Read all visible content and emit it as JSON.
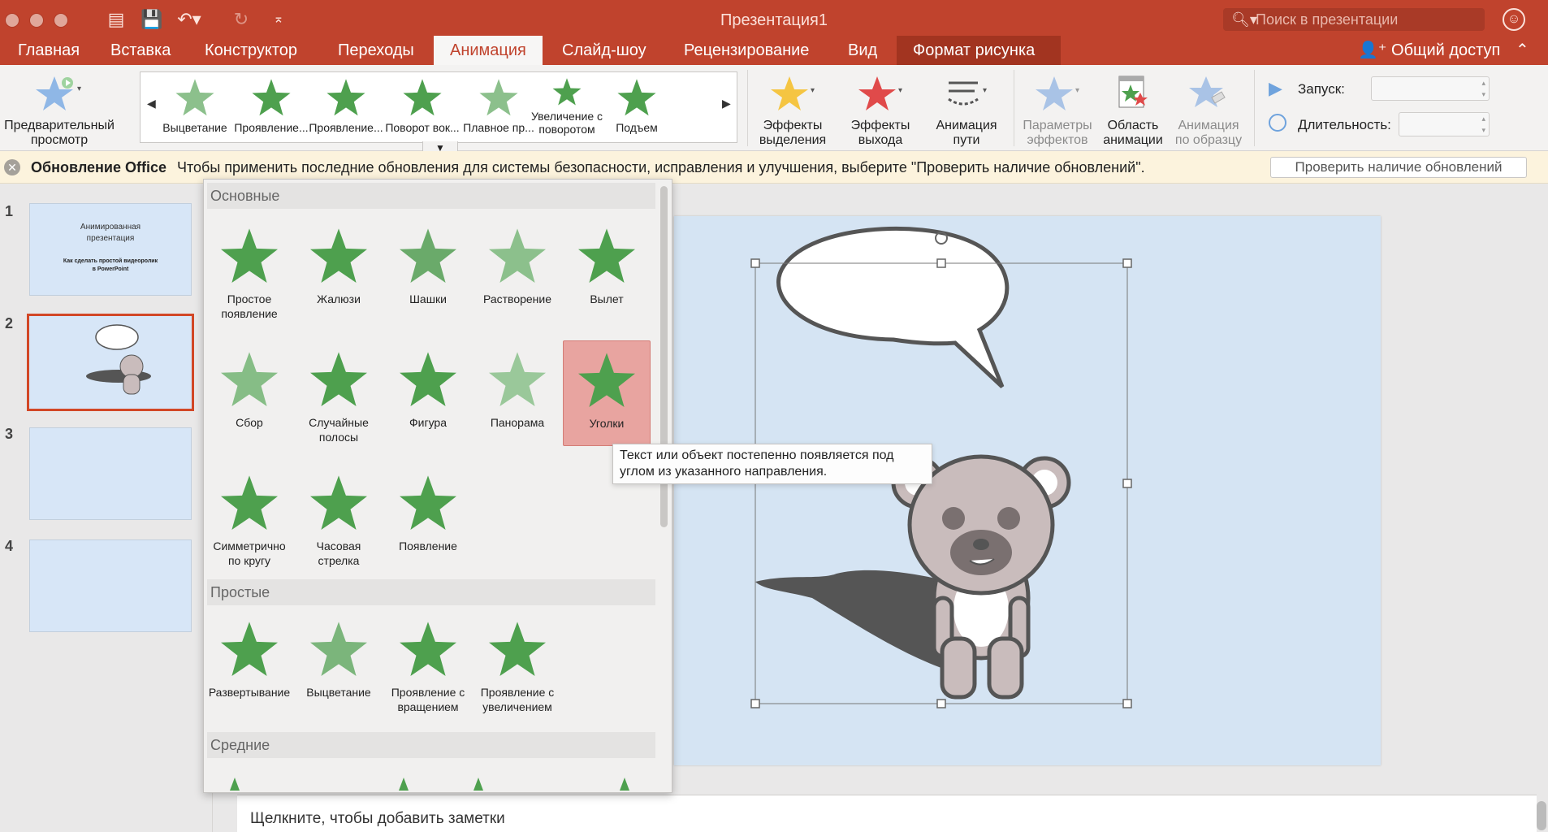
{
  "window": {
    "title": "Презентация1",
    "search_placeholder": "Поиск в презентации"
  },
  "tabs": [
    "Главная",
    "Вставка",
    "Конструктор",
    "Переходы",
    "Анимация",
    "Слайд-шоу",
    "Рецензирование",
    "Вид",
    "Формат рисунка"
  ],
  "active_tab": "Анимация",
  "share_label": "Общий доступ",
  "ribbon": {
    "preview": [
      "Предварительный",
      "просмотр"
    ],
    "gallery_items": [
      {
        "label": "Выцветание",
        "icon": "star-fade-icon"
      },
      {
        "label": "Проявление...",
        "icon": "star-spin-icon"
      },
      {
        "label": "Проявление...",
        "icon": "star-zoom-icon"
      },
      {
        "label": "Поворот вок...",
        "icon": "star-turn-icon"
      },
      {
        "label": "Плавное пр...",
        "icon": "star-float-icon"
      },
      {
        "label": "Увеличение с поворотом",
        "icon": "star-grow-turn-icon"
      },
      {
        "label": "Подъем",
        "icon": "star-rise-icon"
      }
    ],
    "effects_emphasis": [
      "Эффекты",
      "выделения"
    ],
    "effects_exit": [
      "Эффекты",
      "выхода"
    ],
    "motion_path": [
      "Анимация",
      "пути"
    ],
    "effect_options": [
      "Параметры",
      "эффектов"
    ],
    "animation_pane": [
      "Область",
      "анимации"
    ],
    "animation_painter": [
      "Анимация",
      "по образцу"
    ],
    "start_label": "Запуск:",
    "duration_label": "Длительность:"
  },
  "message_bar": {
    "title": "Обновление Office",
    "text": "Чтобы применить последние обновления для системы безопасности, исправления и улучшения, выберите \"Проверить наличие обновлений\".",
    "button": "Проверить наличие обновлений"
  },
  "slides": [
    {
      "number": "1",
      "title": "Анимированная презентация",
      "subtitle": "Как сделать простой видеоролик в PowerPoint"
    },
    {
      "number": "2"
    },
    {
      "number": "3"
    },
    {
      "number": "4"
    }
  ],
  "selected_slide": "2",
  "dropdown": {
    "sections": [
      {
        "title": "Основные",
        "items": [
          "Простое появление",
          "Жалюзи",
          "Шашки",
          "Растворение",
          "Вылет",
          "Сбор",
          "Случайные полосы",
          "Фигура",
          "Панорама",
          "Уголки",
          "Симметрично по кругу",
          "Часовая стрелка",
          "Появление"
        ]
      },
      {
        "title": "Простые",
        "items": [
          "Развертывание",
          "Выцветание",
          "Проявление с вращением",
          "Проявление с увеличением"
        ]
      },
      {
        "title": "Средние",
        "items": []
      }
    ],
    "highlighted": "Уголки"
  },
  "tooltip": "Текст или объект постепенно появляется под углом из указанного направления.",
  "notes_placeholder": "Щелкните, чтобы добавить заметки",
  "colors": {
    "brand": "#c0432d",
    "star_green": "#4ea04e",
    "highlight": "#e8a4a0",
    "slide_bg": "#d5e4f3"
  }
}
